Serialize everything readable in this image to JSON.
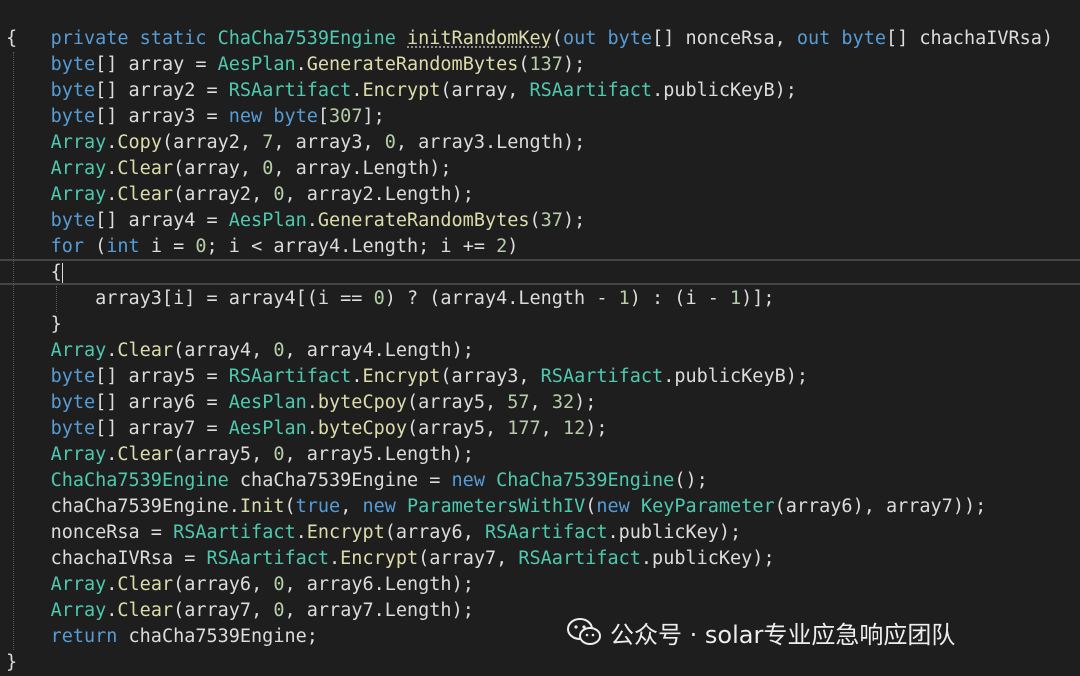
{
  "code": {
    "l0": {
      "kw1": "private",
      "kw2": "static",
      "type": "ChaCha7539Engine",
      "method": "initRandomKey",
      "p1": "(",
      "out1": "out",
      "byte1": "byte",
      "p2": "[] nonceRsa, ",
      "out2": "out",
      "byte2": "byte",
      "p3": "[] chachaIVRsa)"
    },
    "l1": "{",
    "l2": {
      "a": "byte",
      "b": "[] array = ",
      "c": "AesPlan",
      "d": ".",
      "e": "GenerateRandomBytes",
      "f": "(",
      "g": "137",
      "h": ");"
    },
    "l3": {
      "a": "byte",
      "b": "[] array2 = ",
      "c": "RSAartifact",
      "d": ".",
      "e": "Encrypt",
      "f": "(array, ",
      "g": "RSAartifact",
      "h": ".publicKeyB);"
    },
    "l4": {
      "a": "byte",
      "b": "[] array3 = ",
      "c": "new",
      "d": " ",
      "e": "byte",
      "f": "[",
      "g": "307",
      "h": "];"
    },
    "l5": {
      "a": "Array",
      "b": ".",
      "c": "Copy",
      "d": "(array2, ",
      "e": "7",
      "f": ", array3, ",
      "g": "0",
      "h": ", array3.Length);"
    },
    "l6": {
      "a": "Array",
      "b": ".",
      "c": "Clear",
      "d": "(array, ",
      "e": "0",
      "f": ", array.Length);"
    },
    "l7": {
      "a": "Array",
      "b": ".",
      "c": "Clear",
      "d": "(array2, ",
      "e": "0",
      "f": ", array2.Length);"
    },
    "l8": {
      "a": "byte",
      "b": "[] array4 = ",
      "c": "AesPlan",
      "d": ".",
      "e": "GenerateRandomBytes",
      "f": "(",
      "g": "37",
      "h": ");"
    },
    "l9": {
      "a": "for",
      "b": " (",
      "c": "int",
      "d": " i = ",
      "e": "0",
      "f": "; i < array4.Length; i += ",
      "g": "2",
      "h": ")"
    },
    "l10": "{",
    "l11": {
      "a": "array3[i] = array4[(i == ",
      "b": "0",
      "c": ") ? (array4.Length - ",
      "d": "1",
      "e": ") : (i - ",
      "f": "1",
      "g": ")];"
    },
    "l12": "}",
    "l13": {
      "a": "Array",
      "b": ".",
      "c": "Clear",
      "d": "(array4, ",
      "e": "0",
      "f": ", array4.Length);"
    },
    "l14": {
      "a": "byte",
      "b": "[] array5 = ",
      "c": "RSAartifact",
      "d": ".",
      "e": "Encrypt",
      "f": "(array3, ",
      "g": "RSAartifact",
      "h": ".publicKeyB);"
    },
    "l15": {
      "a": "byte",
      "b": "[] array6 = ",
      "c": "AesPlan",
      "d": ".",
      "e": "byteCpoy",
      "f": "(array5, ",
      "g": "57",
      "h": ", ",
      "i": "32",
      "j": ");"
    },
    "l16": {
      "a": "byte",
      "b": "[] array7 = ",
      "c": "AesPlan",
      "d": ".",
      "e": "byteCpoy",
      "f": "(array5, ",
      "g": "177",
      "h": ", ",
      "i": "12",
      "j": ");"
    },
    "l17": {
      "a": "Array",
      "b": ".",
      "c": "Clear",
      "d": "(array5, ",
      "e": "0",
      "f": ", array5.Length);"
    },
    "l18": {
      "a": "ChaCha7539Engine",
      "b": " chaCha7539Engine = ",
      "c": "new",
      "d": " ",
      "e": "ChaCha7539Engine",
      "f": "();"
    },
    "l19": {
      "a": "chaCha7539Engine.",
      "b": "Init",
      "c": "(",
      "d": "true",
      "e": ", ",
      "f": "new",
      "g": " ",
      "h": "ParametersWithIV",
      "i": "(",
      "j": "new",
      "k": " ",
      "l": "KeyParameter",
      "m": "(array6), array7));"
    },
    "l20": {
      "a": "nonceRsa = ",
      "b": "RSAartifact",
      "c": ".",
      "d": "Encrypt",
      "e": "(array6, ",
      "f": "RSAartifact",
      "g": ".publicKey);"
    },
    "l21": {
      "a": "chachaIVRsa = ",
      "b": "RSAartifact",
      "c": ".",
      "d": "Encrypt",
      "e": "(array7, ",
      "f": "RSAartifact",
      "g": ".publicKey);"
    },
    "l22": {
      "a": "Array",
      "b": ".",
      "c": "Clear",
      "d": "(array6, ",
      "e": "0",
      "f": ", array6.Length);"
    },
    "l23": {
      "a": "Array",
      "b": ".",
      "c": "Clear",
      "d": "(array7, ",
      "e": "0",
      "f": ", array7.Length);"
    },
    "l24": {
      "a": "return",
      "b": " chaCha7539Engine;"
    },
    "l25": "}"
  },
  "watermark": {
    "icon": "wechat-icon",
    "text": "公众号 · solar专业应急响应团队"
  },
  "colors": {
    "background": "#1e1e1e",
    "keyword": "#569cd6",
    "type": "#4ec9b0",
    "number": "#b5cea8",
    "method": "#dcdcaa",
    "text": "#dcdcdc"
  }
}
